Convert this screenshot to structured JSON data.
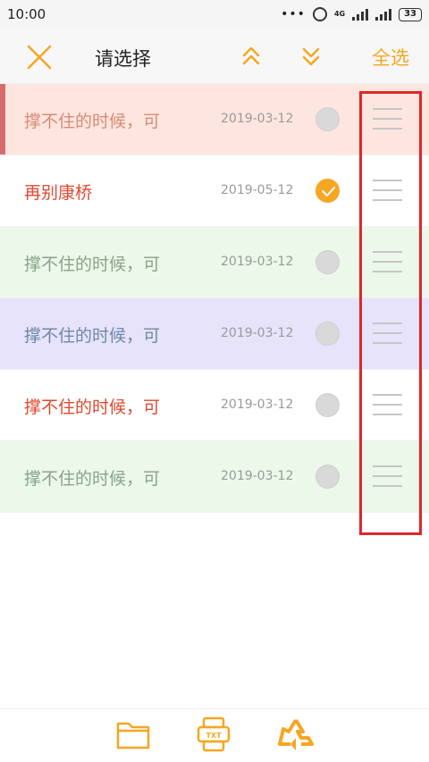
{
  "status": {
    "time": "10:00",
    "dots": "•••",
    "network": "4G",
    "battery": "33"
  },
  "toolbar": {
    "title": "请选择",
    "select_all": "全选"
  },
  "colors": {
    "accent": "#f5a623",
    "highlight": "#e0262b"
  },
  "items": [
    {
      "title": "撑不住的时候，可",
      "date": "2019-03-12",
      "checked": false,
      "bg": "#fde6df",
      "color": "#d98a74",
      "bar": "#d76c6c"
    },
    {
      "title": "再别康桥",
      "date": "2019-05-12",
      "checked": true,
      "bg": "#ffffff",
      "color": "#e0492f",
      "bar": ""
    },
    {
      "title": "撑不住的时候，可",
      "date": "2019-03-12",
      "checked": false,
      "bg": "#ebf8ea",
      "color": "#8aa38a",
      "bar": ""
    },
    {
      "title": "撑不住的时候，可",
      "date": "2019-03-12",
      "checked": false,
      "bg": "#e6e3fb",
      "color": "#6f88a8",
      "bar": ""
    },
    {
      "title": "撑不住的时候，可",
      "date": "2019-03-12",
      "checked": false,
      "bg": "#ffffff",
      "color": "#e0492f",
      "bar": ""
    },
    {
      "title": "撑不住的时候，可",
      "date": "2019-03-12",
      "checked": false,
      "bg": "#ebf8ea",
      "color": "#8aa38a",
      "bar": ""
    }
  ],
  "bottom": {
    "txt_label": "TXT",
    "icons": [
      "folder-icon",
      "txt-file-icon",
      "recycle-icon"
    ]
  }
}
